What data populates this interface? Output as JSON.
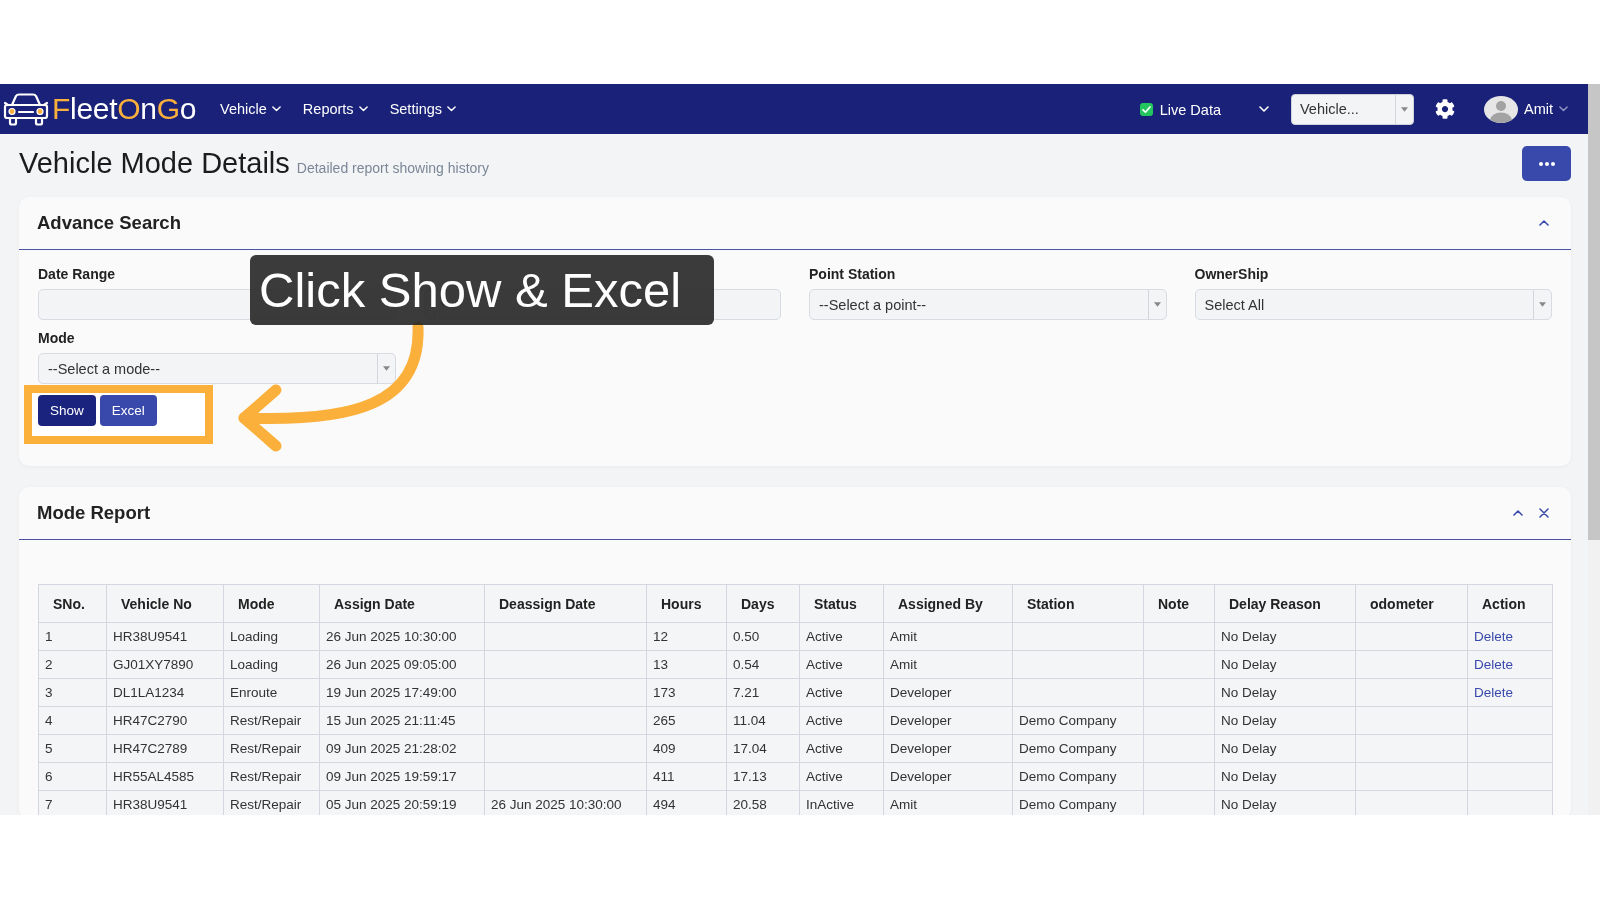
{
  "navbar": {
    "logo": [
      {
        "text": "F",
        "accent": true
      },
      {
        "text": "leet",
        "accent": false
      },
      {
        "text": "O",
        "accent": true
      },
      {
        "text": "n",
        "accent": false
      },
      {
        "text": "G",
        "accent": true
      },
      {
        "text": "o",
        "accent": false
      }
    ],
    "menu": [
      {
        "label": "Vehicle"
      },
      {
        "label": "Reports"
      },
      {
        "label": "Settings"
      }
    ],
    "live_data": {
      "label": "Live Data",
      "checked": true
    },
    "vehicle_select": {
      "value": "Vehicle..."
    },
    "user": {
      "name": "Amit"
    }
  },
  "page": {
    "title": "Vehicle Mode Details",
    "subtitle": "Detailed report showing history"
  },
  "advance_search": {
    "title": "Advance Search",
    "fields": [
      {
        "kind": "date",
        "label": "Date Range"
      },
      {
        "kind": "select"
      },
      {
        "kind": "select",
        "label": "Point Station",
        "value": "--Select a point--"
      },
      {
        "kind": "select",
        "label": "OwnerShip",
        "value": "Select All"
      },
      {
        "kind": "select",
        "label": "Mode",
        "value": "--Select a mode--"
      }
    ],
    "buttons": [
      {
        "label": "Show",
        "kind": "primary"
      },
      {
        "label": "Excel",
        "kind": "secondary"
      }
    ]
  },
  "tutorial_callout": {
    "text": "Click Show & Excel"
  },
  "mode_report": {
    "title": "Mode Report",
    "columns": [
      "SNo.",
      "Vehicle No",
      "Mode",
      "Assign Date",
      "Deassign Date",
      "Hours",
      "Days",
      "Status",
      "Assigned By",
      "Station",
      "Note",
      "Delay Reason",
      "odometer",
      "Action"
    ],
    "rows": [
      {
        "sno": "1",
        "vehicle_no": "HR38U9541",
        "mode": "Loading",
        "assign_date": "26 Jun 2025 10:30:00",
        "hours": "12",
        "days": "0.50",
        "status": "Active",
        "assigned_by": "Amit",
        "delay_reason": "No Delay",
        "action": "Delete"
      },
      {
        "sno": "2",
        "vehicle_no": "GJ01XY7890",
        "mode": "Loading",
        "assign_date": "26 Jun 2025 09:05:00",
        "hours": "13",
        "days": "0.54",
        "status": "Active",
        "assigned_by": "Amit",
        "delay_reason": "No Delay",
        "action": "Delete"
      },
      {
        "sno": "3",
        "vehicle_no": "DL1LA1234",
        "mode": "Enroute",
        "assign_date": "19 Jun 2025 17:49:00",
        "hours": "173",
        "days": "7.21",
        "status": "Active",
        "assigned_by": "Developer",
        "delay_reason": "No Delay",
        "action": "Delete"
      },
      {
        "sno": "4",
        "vehicle_no": "HR47C2790",
        "mode": "Rest/Repair",
        "assign_date": "15 Jun 2025 21:11:45",
        "hours": "265",
        "days": "11.04",
        "status": "Active",
        "assigned_by": "Developer",
        "station": "Demo Company",
        "delay_reason": "No Delay"
      },
      {
        "sno": "5",
        "vehicle_no": "HR47C2789",
        "mode": "Rest/Repair",
        "assign_date": "09 Jun 2025 21:28:02",
        "hours": "409",
        "days": "17.04",
        "status": "Active",
        "assigned_by": "Developer",
        "station": "Demo Company",
        "delay_reason": "No Delay"
      },
      {
        "sno": "6",
        "vehicle_no": "HR55AL4585",
        "mode": "Rest/Repair",
        "assign_date": "09 Jun 2025 19:59:17",
        "hours": "411",
        "days": "17.13",
        "status": "Active",
        "assigned_by": "Developer",
        "station": "Demo Company",
        "delay_reason": "No Delay"
      },
      {
        "sno": "7",
        "vehicle_no": "HR38U9541",
        "mode": "Rest/Repair",
        "assign_date": "05 Jun 2025 20:59:19",
        "deassign_date": "26 Jun 2025 10:30:00",
        "hours": "494",
        "days": "20.58",
        "status": "InActive",
        "assigned_by": "Amit",
        "station": "Demo Company",
        "delay_reason": "No Delay"
      }
    ]
  }
}
